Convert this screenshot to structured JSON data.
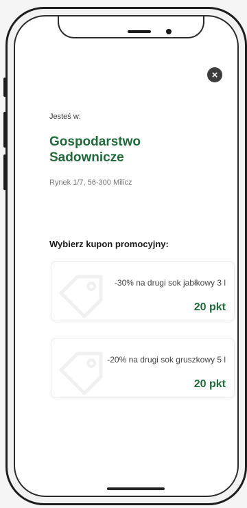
{
  "header": {
    "close_label": "×"
  },
  "location": {
    "label": "Jesteś w:",
    "name": "Gospodarstwo Sadownicze",
    "address": "Rynek 1/7, 56-300 Milicz"
  },
  "coupons": {
    "heading": "Wybierz kupon promocyjny:",
    "items": [
      {
        "description": "-30% na drugi sok jabłkowy 3 l",
        "points": "20 pkt"
      },
      {
        "description": "-20% na drugi sok gruszkowy 5 l",
        "points": "20 pkt"
      }
    ]
  },
  "colors": {
    "accent": "#1f6b3a",
    "close_button": "#3d3d3d"
  },
  "icons": {
    "close": "close-icon",
    "coupon": "tag-icon"
  }
}
